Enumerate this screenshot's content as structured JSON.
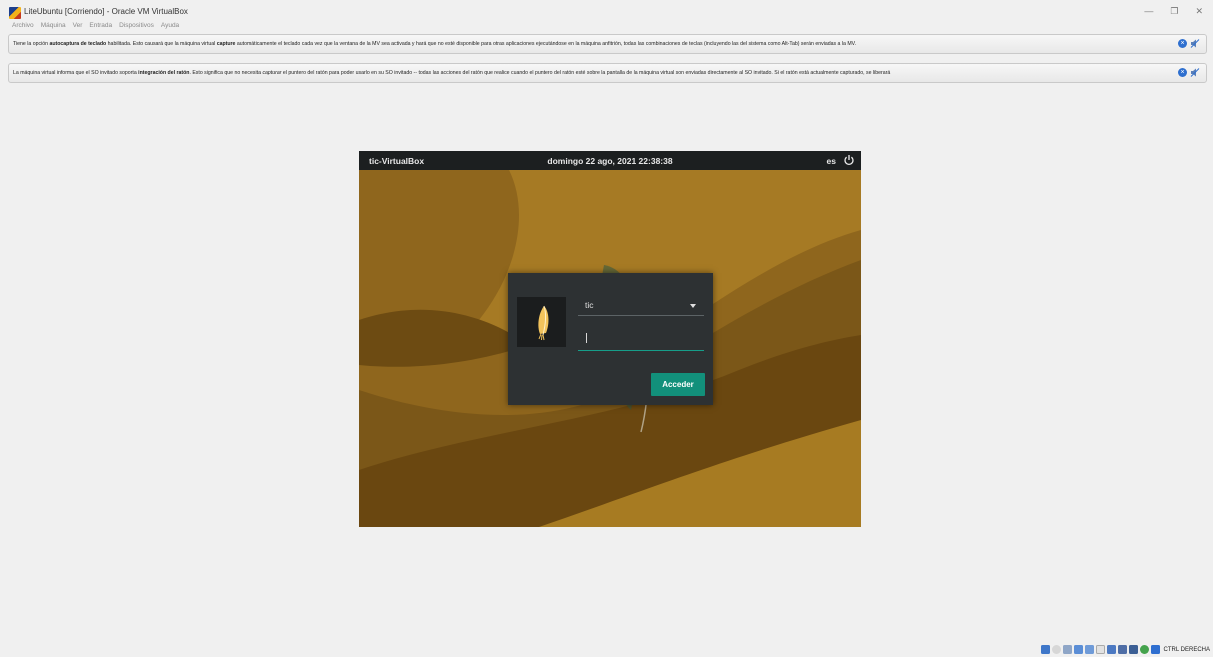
{
  "window": {
    "title": "LiteUbuntu [Corriendo] - Oracle VM VirtualBox",
    "controls": {
      "minimize": "—",
      "restore": "❐",
      "close": "✕"
    }
  },
  "menu": [
    "Archivo",
    "Máquina",
    "Ver",
    "Entrada",
    "Dispositivos",
    "Ayuda"
  ],
  "notices": [
    {
      "parts": [
        {
          "t": "Tiene la opción "
        },
        {
          "t": "autocaptura de teclado",
          "b": true
        },
        {
          "t": " habilitada. Esto causará que la máquina virtual "
        },
        {
          "t": "capture",
          "b": true
        },
        {
          "t": " automáticamente el teclado cada vez que la ventana de la MV sea activada y hará que no esté disponible para otras aplicaciones ejecutándose en la máquina anfitrión, todas las combinaciones de teclas (incluyendo las del sistema como Alt-Tab) serán enviadas a la MV."
        }
      ]
    },
    {
      "parts": [
        {
          "t": "La máquina virtual informa que el SO invitado soporta "
        },
        {
          "t": "integración del ratón",
          "b": true
        },
        {
          "t": ". Esto significa que no necesita "
        },
        {
          "t": "capturar",
          "i": true
        },
        {
          "t": " el puntero del ratón para poder usarlo en su SO invitado -- todas las acciones del ratón que realice cuando el puntero del ratón esté sobre la pantalla de la máquina virtual son enviadas directamente al SO invitado. Si el ratón está actualmente capturado, se liberará"
        }
      ]
    }
  ],
  "vm": {
    "hostname": "tic-VirtualBox",
    "datetime": "domingo 22 ago, 2021 22:38:38",
    "lang": "es",
    "power_icon": "power-icon",
    "login": {
      "username": "tic",
      "password": "",
      "button": "Acceder"
    }
  },
  "status": {
    "icons": [
      "hard-disk-icon",
      "optical-drive-icon",
      "audio-icon",
      "network-icon",
      "usb-icon",
      "shared-folders-icon",
      "display-icon",
      "video-capture-icon",
      "cpu-icon",
      "mouse-integration-icon",
      "keyboard-icon"
    ],
    "host_key": "CTRL DERECHA"
  },
  "colors": {
    "accent": "#12907b",
    "panel": "#1c1f20",
    "dialog": "#2d3133"
  }
}
